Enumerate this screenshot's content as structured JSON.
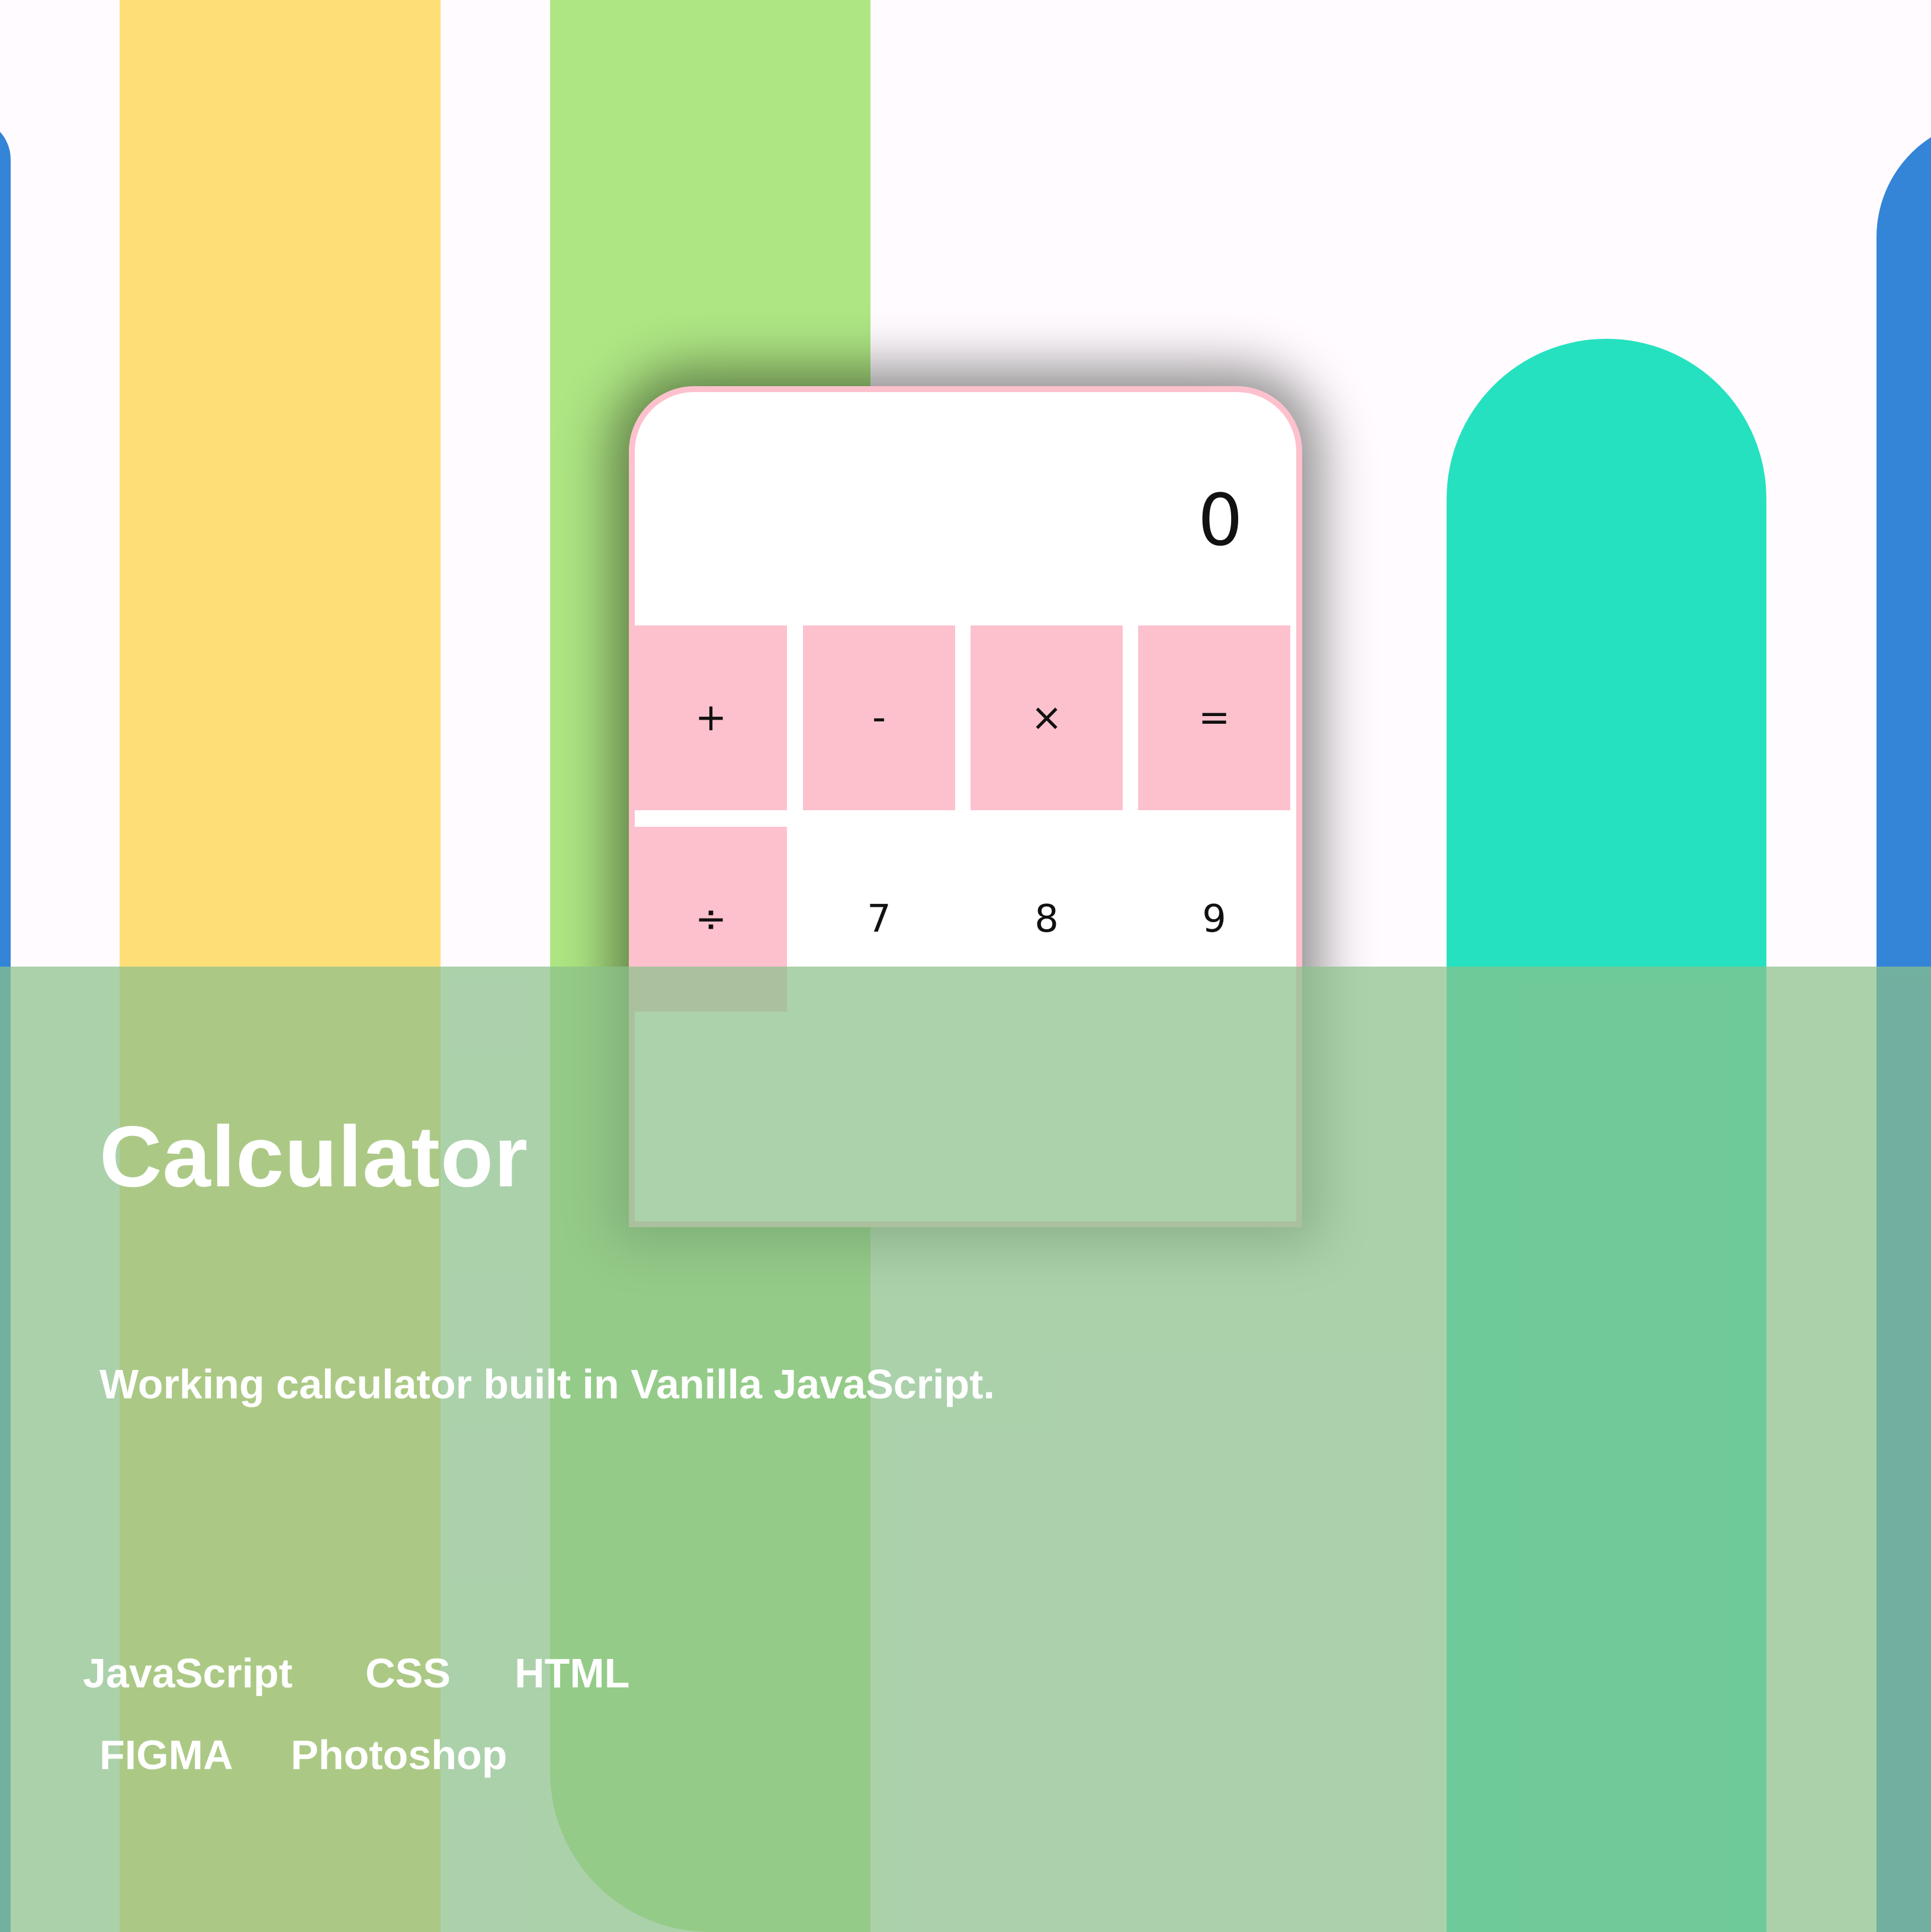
{
  "calculator": {
    "display_value": "0",
    "keys": [
      {
        "label": "+",
        "type": "operator",
        "name": "plus"
      },
      {
        "label": "-",
        "type": "operator",
        "name": "minus"
      },
      {
        "label": "×",
        "type": "operator",
        "name": "multiply"
      },
      {
        "label": "=",
        "type": "operator",
        "name": "equals"
      },
      {
        "label": "÷",
        "type": "operator",
        "name": "divide"
      },
      {
        "label": "7",
        "type": "number",
        "name": "7"
      },
      {
        "label": "8",
        "type": "number",
        "name": "8"
      },
      {
        "label": "9",
        "type": "number",
        "name": "9"
      }
    ]
  },
  "project": {
    "title": "Calculator",
    "description": "Working calculator built in Vanilla JavaScript.",
    "tags": [
      "JavaScript",
      "CSS",
      "HTML",
      "FIGMA",
      "Photoshop"
    ]
  },
  "colors": {
    "yellow_bar": "#fedf77",
    "green_bar": "#aee683",
    "teal_bar": "#25e1bf",
    "blue_bar": "#3484d8",
    "operator_key": "#fdc1cd",
    "overlay": "#8bc08b"
  }
}
